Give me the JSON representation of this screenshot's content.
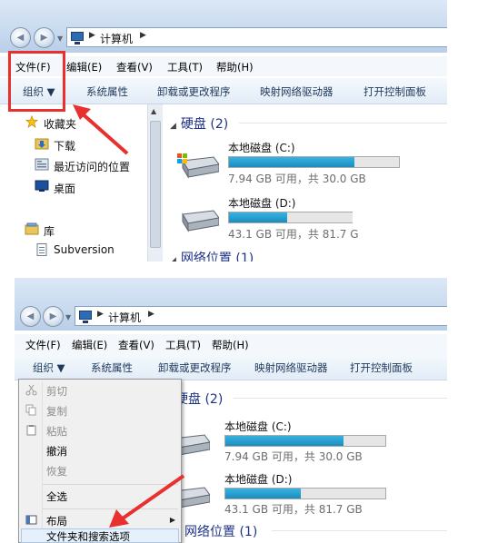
{
  "window1": {
    "breadcrumb": "计算机",
    "menu": [
      "文件(F)",
      "编辑(E)",
      "查看(V)",
      "工具(T)",
      "帮助(H)"
    ],
    "toolbar": {
      "organize": "组织 ▼",
      "items": [
        "系统属性",
        "卸载或更改程序",
        "映射网络驱动器",
        "打开控制面板"
      ]
    },
    "nav": [
      {
        "label": "收藏夹",
        "icon": "star-icon"
      },
      {
        "label": "下载",
        "icon": "download-folder-icon"
      },
      {
        "label": "最近访问的位置",
        "icon": "recent-places-icon"
      },
      {
        "label": "桌面",
        "icon": "desktop-icon"
      },
      {
        "label": "库",
        "icon": "library-icon"
      },
      {
        "label": "Subversion",
        "icon": "document-icon"
      }
    ],
    "groups": {
      "hard_disk": "硬盘 (2)",
      "network": "网络位置 (1)"
    },
    "drives": [
      {
        "name": "本地磁盘 (C:)",
        "size": "7.94 GB 可用，共 30.0 GB",
        "used_fraction": 0.74
      },
      {
        "name": "本地磁盘 (D:)",
        "size": "43.1 GB 可用，共 81.7 G",
        "used_fraction": 0.47
      }
    ]
  },
  "window2": {
    "breadcrumb": "计算机",
    "menu": [
      "文件(F)",
      "编辑(E)",
      "查看(V)",
      "工具(T)",
      "帮助(H)"
    ],
    "toolbar": {
      "organize": "组织 ▼",
      "items": [
        "系统属性",
        "卸载或更改程序",
        "映射网络驱动器",
        "打开控制面板"
      ]
    },
    "groups": {
      "hard_disk": "硬盘 (2)",
      "network": "网络位置 (1)"
    },
    "drives": [
      {
        "name": "本地磁盘 (C:)",
        "size": "7.94 GB 可用，共 30.0 GB",
        "used_fraction": 0.74
      },
      {
        "name": "本地磁盘 (D:)",
        "size": "43.1 GB 可用，共 81.7 GB",
        "used_fraction": 0.47
      }
    ],
    "context_menu": {
      "cut": "剪切",
      "copy": "复制",
      "paste": "粘贴",
      "undo": "撤消",
      "redo": "恢复",
      "select_all": "全选",
      "layout": "布局",
      "folder_options": "文件夹和搜索选项"
    }
  },
  "colors": {
    "annotation": "#e8312f",
    "drive_fill": "#26a0d4",
    "group_header": "#1e3287"
  }
}
